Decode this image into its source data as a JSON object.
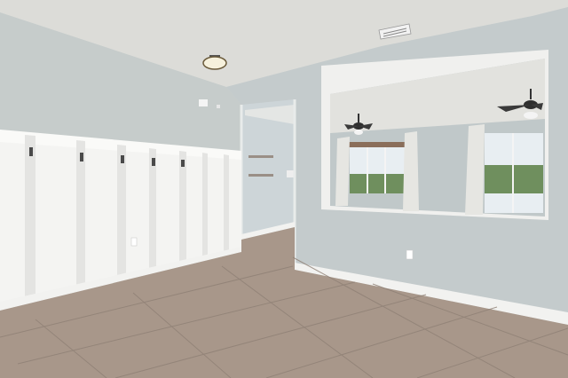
{
  "scene": {
    "description_visible_text": "",
    "colors": {
      "ceiling": "#dcdcd8",
      "wall": "#c4cbcc",
      "wall_shadow": "#b3babc",
      "wainscot": "#f4f4f2",
      "baseboard": "#f2f2f0",
      "floor": "#a8978a",
      "floor_dark": "#94847a",
      "grout": "#8a7c72",
      "window_sky": "#e8eef2",
      "greenery": "#6f8f5e",
      "curtain": "#e6e6e2"
    },
    "icons": [
      "ceiling-light-icon",
      "ceiling-fan-icon",
      "hvac-vent-icon",
      "coat-hook-icon",
      "electrical-outlet-icon"
    ]
  }
}
